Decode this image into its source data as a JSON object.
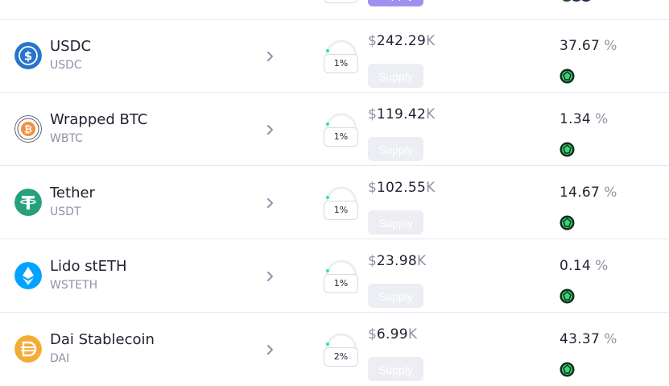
{
  "colors": {
    "usdc": "#2775CA",
    "wbtc_orange": "#F09242",
    "tether": "#26A17B",
    "lido": "#00A3FF",
    "dai": "#F5AC37",
    "gauge_dot": "#2ee59d",
    "reward_green": "#3fcf7a",
    "supply_button": "#eceef3",
    "top_supply_button": "#a08ff0"
  },
  "top_partial": {
    "supply_label": "Supply"
  },
  "assets": [
    {
      "name": "USDC",
      "symbol": "USDC",
      "icon": "usdc-icon",
      "utilization": "1%",
      "utilization_fraction": 0.01,
      "currency": "$",
      "liquidity": "242.29",
      "unit": "K",
      "supply_label": "Supply",
      "apy": "37.67",
      "apy_unit": "%",
      "reward_icon": "reward-token-icon"
    },
    {
      "name": "Wrapped BTC",
      "symbol": "WBTC",
      "icon": "wbtc-icon",
      "utilization": "1%",
      "utilization_fraction": 0.01,
      "currency": "$",
      "liquidity": "119.42",
      "unit": "K",
      "supply_label": "Supply",
      "apy": "1.34",
      "apy_unit": "%",
      "reward_icon": "reward-token-icon"
    },
    {
      "name": "Tether",
      "symbol": "USDT",
      "icon": "tether-icon",
      "utilization": "1%",
      "utilization_fraction": 0.01,
      "currency": "$",
      "liquidity": "102.55",
      "unit": "K",
      "supply_label": "Supply",
      "apy": "14.67",
      "apy_unit": "%",
      "reward_icon": "reward-token-icon"
    },
    {
      "name": "Lido stETH",
      "symbol": "WSTETH",
      "icon": "lido-icon",
      "utilization": "1%",
      "utilization_fraction": 0.01,
      "currency": "$",
      "liquidity": "23.98",
      "unit": "K",
      "supply_label": "Supply",
      "apy": "0.14",
      "apy_unit": "%",
      "reward_icon": "reward-token-icon"
    },
    {
      "name": "Dai Stablecoin",
      "symbol": "DAI",
      "icon": "dai-icon",
      "utilization": "2%",
      "utilization_fraction": 0.02,
      "currency": "$",
      "liquidity": "6.99",
      "unit": "K",
      "supply_label": "Supply",
      "apy": "43.37",
      "apy_unit": "%",
      "reward_icon": "reward-token-icon"
    }
  ]
}
